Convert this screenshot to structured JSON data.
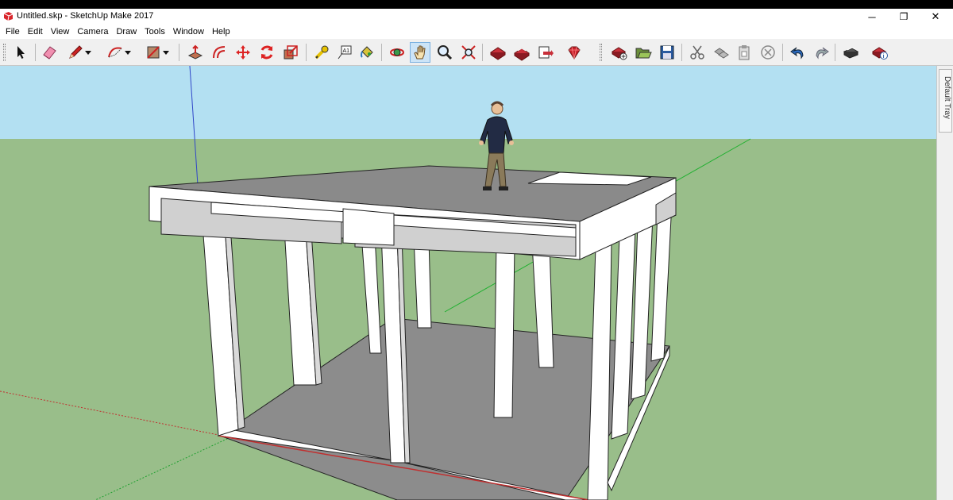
{
  "window": {
    "title": "Untitled.skp - SketchUp Make 2017",
    "minimize_glyph": "─",
    "restore_glyph": "❐",
    "close_glyph": "✕"
  },
  "menu": [
    "File",
    "Edit",
    "View",
    "Camera",
    "Draw",
    "Tools",
    "Window",
    "Help"
  ],
  "toolbar": {
    "tools": [
      {
        "name": "select-tool",
        "icon": "select-arrow-icon"
      },
      {
        "name": "eraser-tool",
        "icon": "eraser-icon"
      },
      {
        "name": "line-tool",
        "icon": "pencil-icon"
      },
      {
        "name": "line-tool-dropdown",
        "icon": "caret-down-icon"
      },
      {
        "name": "arc-tool",
        "icon": "arc-icon"
      },
      {
        "name": "arc-tool-dropdown",
        "icon": "caret-down-icon"
      },
      {
        "name": "rectangle-tool",
        "icon": "rectangle-icon"
      },
      {
        "name": "rectangle-tool-dropdown",
        "icon": "caret-down-icon"
      },
      {
        "name": "push-pull-tool",
        "icon": "push-pull-icon"
      },
      {
        "name": "offset-tool",
        "icon": "offset-icon"
      },
      {
        "name": "move-tool",
        "icon": "move-icon"
      },
      {
        "name": "rotate-tool",
        "icon": "rotate-icon"
      },
      {
        "name": "scale-tool",
        "icon": "scale-icon"
      },
      {
        "name": "tape-measure-tool",
        "icon": "tape-measure-icon"
      },
      {
        "name": "text-tool",
        "icon": "text-icon"
      },
      {
        "name": "paint-bucket-tool",
        "icon": "paint-bucket-icon"
      },
      {
        "name": "orbit-tool",
        "icon": "orbit-icon"
      },
      {
        "name": "pan-tool",
        "icon": "hand-icon"
      },
      {
        "name": "zoom-tool",
        "icon": "magnifier-icon"
      },
      {
        "name": "zoom-extents-tool",
        "icon": "zoom-extents-icon"
      },
      {
        "name": "3d-warehouse-button",
        "icon": "warehouse-icon"
      },
      {
        "name": "share-model-button",
        "icon": "share-model-icon"
      },
      {
        "name": "share-component-button",
        "icon": "share-component-icon"
      },
      {
        "name": "extension-warehouse-button",
        "icon": "ruby-gem-icon"
      },
      {
        "name": "new-file-button",
        "icon": "new-file-icon"
      },
      {
        "name": "open-file-button",
        "icon": "open-folder-icon"
      },
      {
        "name": "save-button",
        "icon": "floppy-disk-icon"
      },
      {
        "name": "cut-button",
        "icon": "scissors-icon"
      },
      {
        "name": "copy-button",
        "icon": "copy-icon"
      },
      {
        "name": "paste-button",
        "icon": "clipboard-icon"
      },
      {
        "name": "erase-button",
        "icon": "circle-x-icon"
      },
      {
        "name": "undo-button",
        "icon": "undo-icon"
      },
      {
        "name": "redo-button",
        "icon": "redo-icon"
      },
      {
        "name": "print-button",
        "icon": "printer-icon"
      },
      {
        "name": "model-info-button",
        "icon": "model-info-icon"
      }
    ],
    "active_tool": "pan-tool"
  },
  "tray": {
    "label": "Default Tray"
  },
  "scene": {
    "sky_color": "#b3e0f2",
    "ground_color": "#99be8a",
    "wall_color": "#ffffff",
    "floor_color": "#8c8c8c",
    "slab_top_color": "#8a8a8a"
  }
}
